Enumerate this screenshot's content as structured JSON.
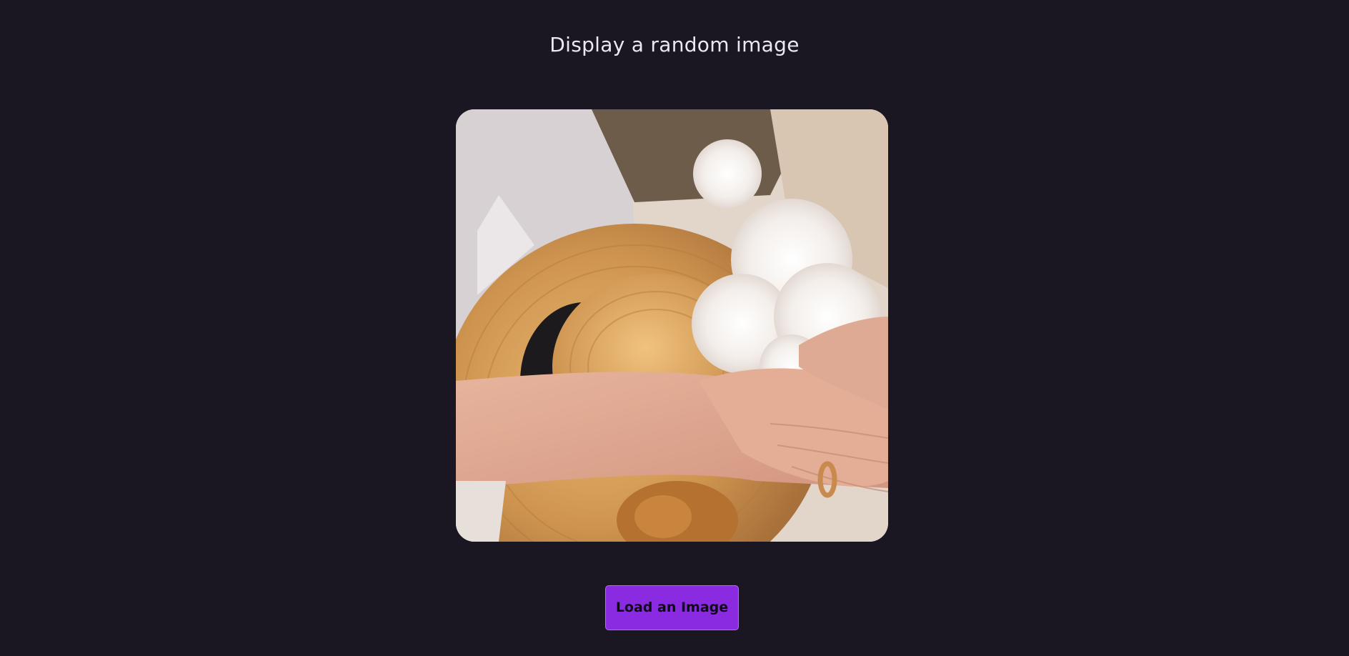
{
  "header": {
    "title": "Display a random image"
  },
  "image": {
    "description_icon": "photo",
    "colors": {
      "background": "#1a1622",
      "accent": "#8a2be2"
    }
  },
  "actions": {
    "load_label": "Load an Image"
  }
}
